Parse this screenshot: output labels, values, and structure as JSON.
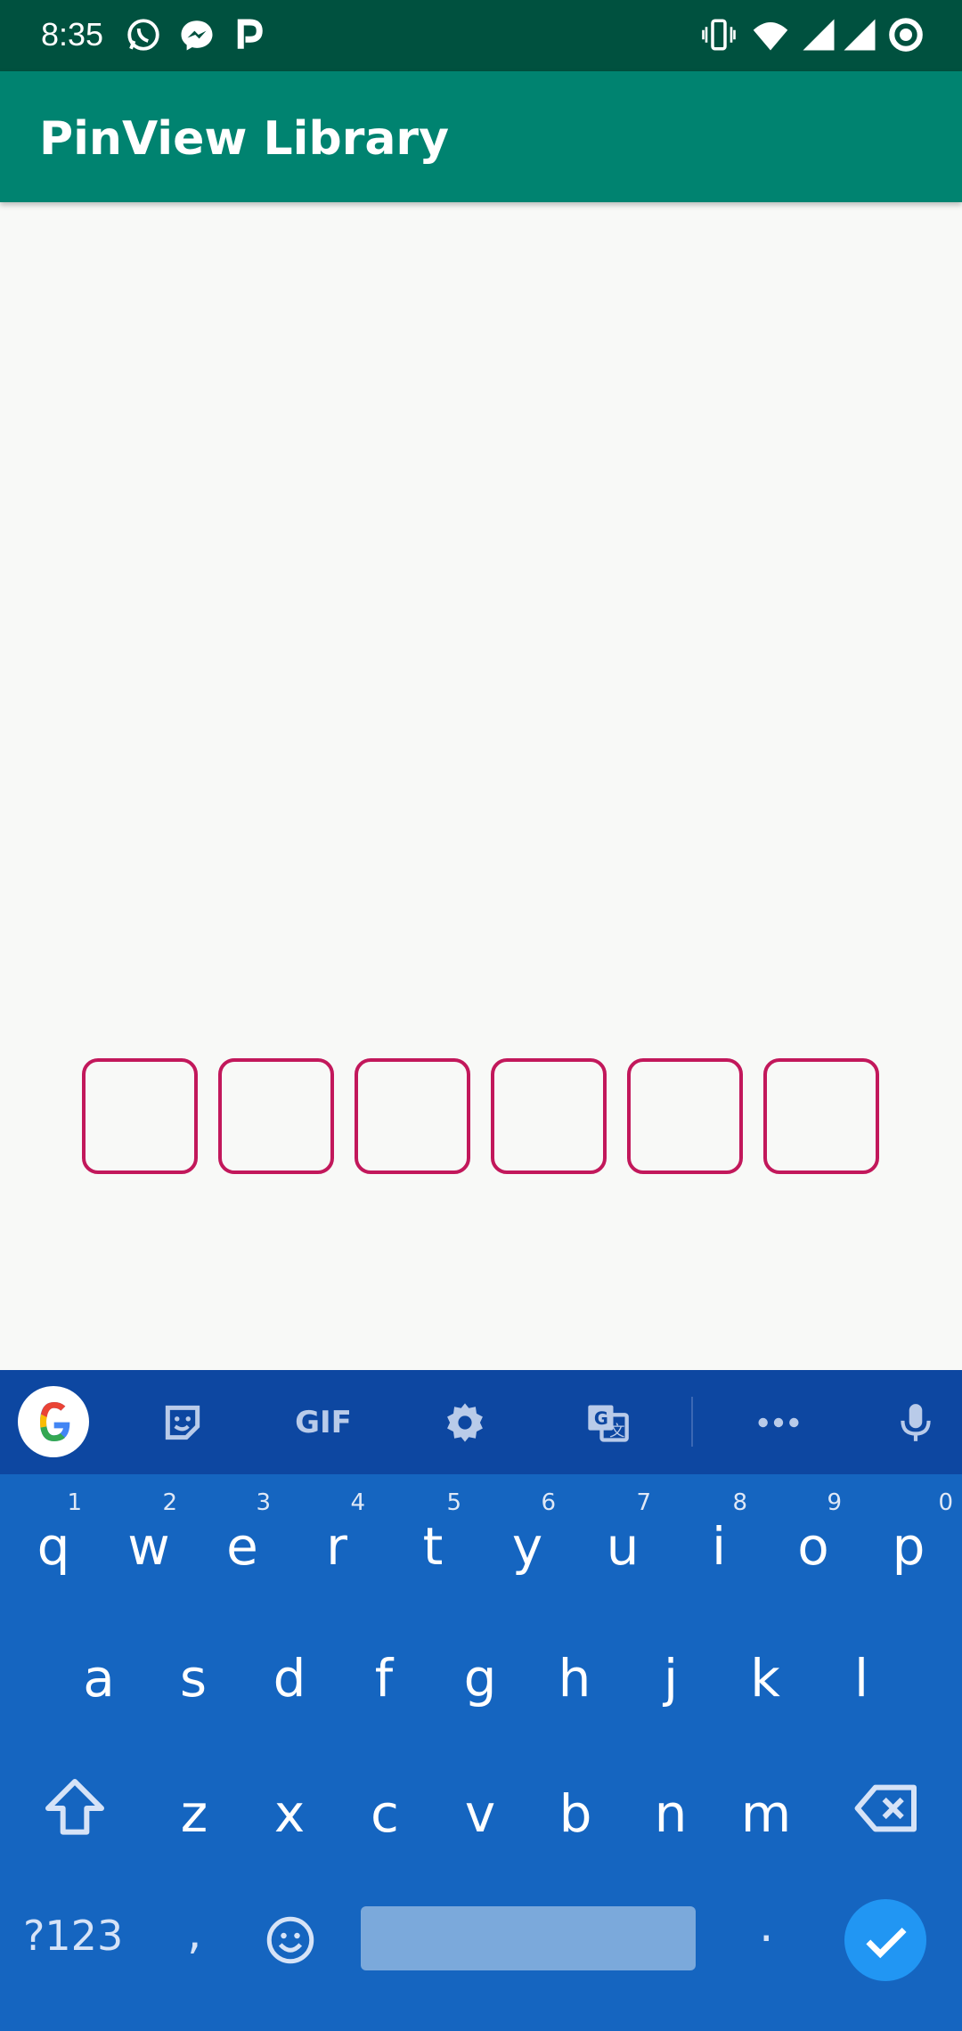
{
  "status_bar": {
    "time": "8:35",
    "left_icons": [
      "whatsapp-icon",
      "messenger-icon",
      "parking-p-icon"
    ],
    "right_icons": [
      "vibrate-icon",
      "wifi-icon",
      "signal-icon",
      "signal-icon",
      "circle-record-icon"
    ]
  },
  "app_bar": {
    "title": "PinView Library",
    "color": "#008370"
  },
  "pin_view": {
    "box_count": 6,
    "border_color": "#c2185b",
    "values": [
      "",
      "",
      "",
      "",
      "",
      ""
    ]
  },
  "keyboard": {
    "toolbar": [
      "google-icon",
      "sticker-icon",
      "GIF",
      "settings-icon",
      "translate-icon",
      "more-icon",
      "mic-icon"
    ],
    "gif_label": "GIF",
    "row1": [
      {
        "k": "q",
        "h": "1"
      },
      {
        "k": "w",
        "h": "2"
      },
      {
        "k": "e",
        "h": "3"
      },
      {
        "k": "r",
        "h": "4"
      },
      {
        "k": "t",
        "h": "5"
      },
      {
        "k": "y",
        "h": "6"
      },
      {
        "k": "u",
        "h": "7"
      },
      {
        "k": "i",
        "h": "8"
      },
      {
        "k": "o",
        "h": "9"
      },
      {
        "k": "p",
        "h": "0"
      }
    ],
    "row2": [
      "a",
      "s",
      "d",
      "f",
      "g",
      "h",
      "j",
      "k",
      "l"
    ],
    "row3": [
      "z",
      "x",
      "c",
      "v",
      "b",
      "n",
      "m"
    ],
    "symbols_label": "?123",
    "comma": ",",
    "period": "."
  }
}
